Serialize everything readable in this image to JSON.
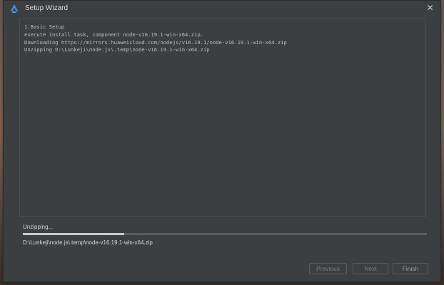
{
  "window": {
    "title": "Setup Wizard",
    "close_glyph": "✕",
    "app_icon": "app-logo-icon"
  },
  "log": {
    "lines": [
      "1.Basic Setup",
      "execute install task, component node-v16.19.1-win-x64.zip.",
      "Downloading https://mirrors.huaweicloud.com/nodejs/v16.19.1/node-v16.19.1-win-x64.zip",
      "Unzipping D:\\Lunkeji\\node.js\\.temp\\node-v16.19.1-win-x64.zip"
    ]
  },
  "progress": {
    "status": "Unzipping...",
    "fraction": 0.25,
    "path": "D:\\Lunkeji\\node.js\\.temp\\node-v16.19.1-win-x64.zip"
  },
  "buttons": {
    "previous": "Previous",
    "next": "Next",
    "finish": "Finish"
  },
  "colors": {
    "window_bg": "#3c3f41",
    "text": "#d6d6d6",
    "accent": "#3d8fd6"
  }
}
